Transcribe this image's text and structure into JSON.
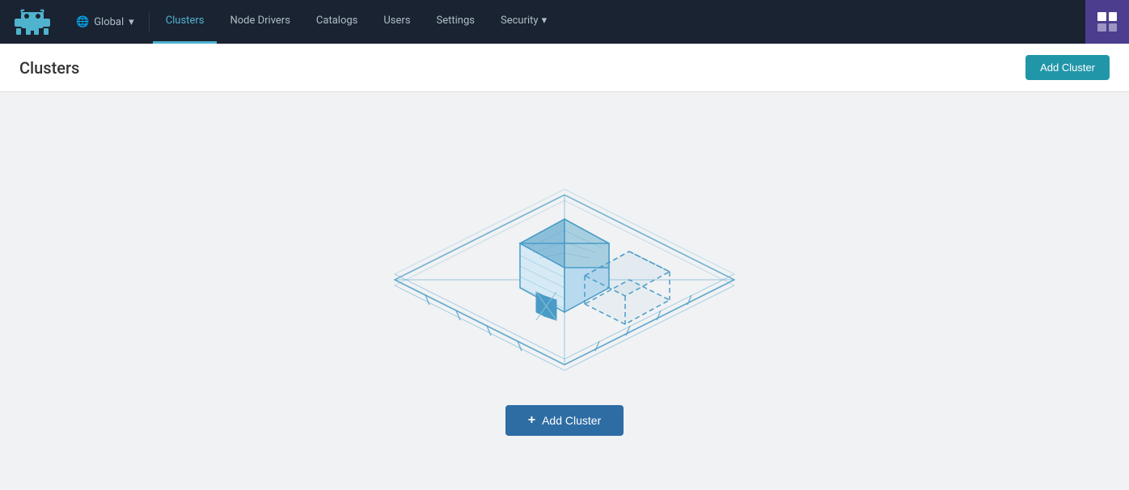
{
  "navbar": {
    "global_label": "Global",
    "chevron": "▾",
    "items": [
      {
        "id": "clusters",
        "label": "Clusters",
        "active": true
      },
      {
        "id": "node-drivers",
        "label": "Node Drivers",
        "active": false
      },
      {
        "id": "catalogs",
        "label": "Catalogs",
        "active": false
      },
      {
        "id": "users",
        "label": "Users",
        "active": false
      },
      {
        "id": "settings",
        "label": "Settings",
        "active": false
      },
      {
        "id": "security",
        "label": "Security",
        "active": false
      }
    ]
  },
  "page": {
    "title": "Clusters",
    "add_cluster_btn": "Add Cluster"
  },
  "empty_state": {
    "add_cluster_btn": "Add Cluster",
    "plus_icon": "+"
  }
}
